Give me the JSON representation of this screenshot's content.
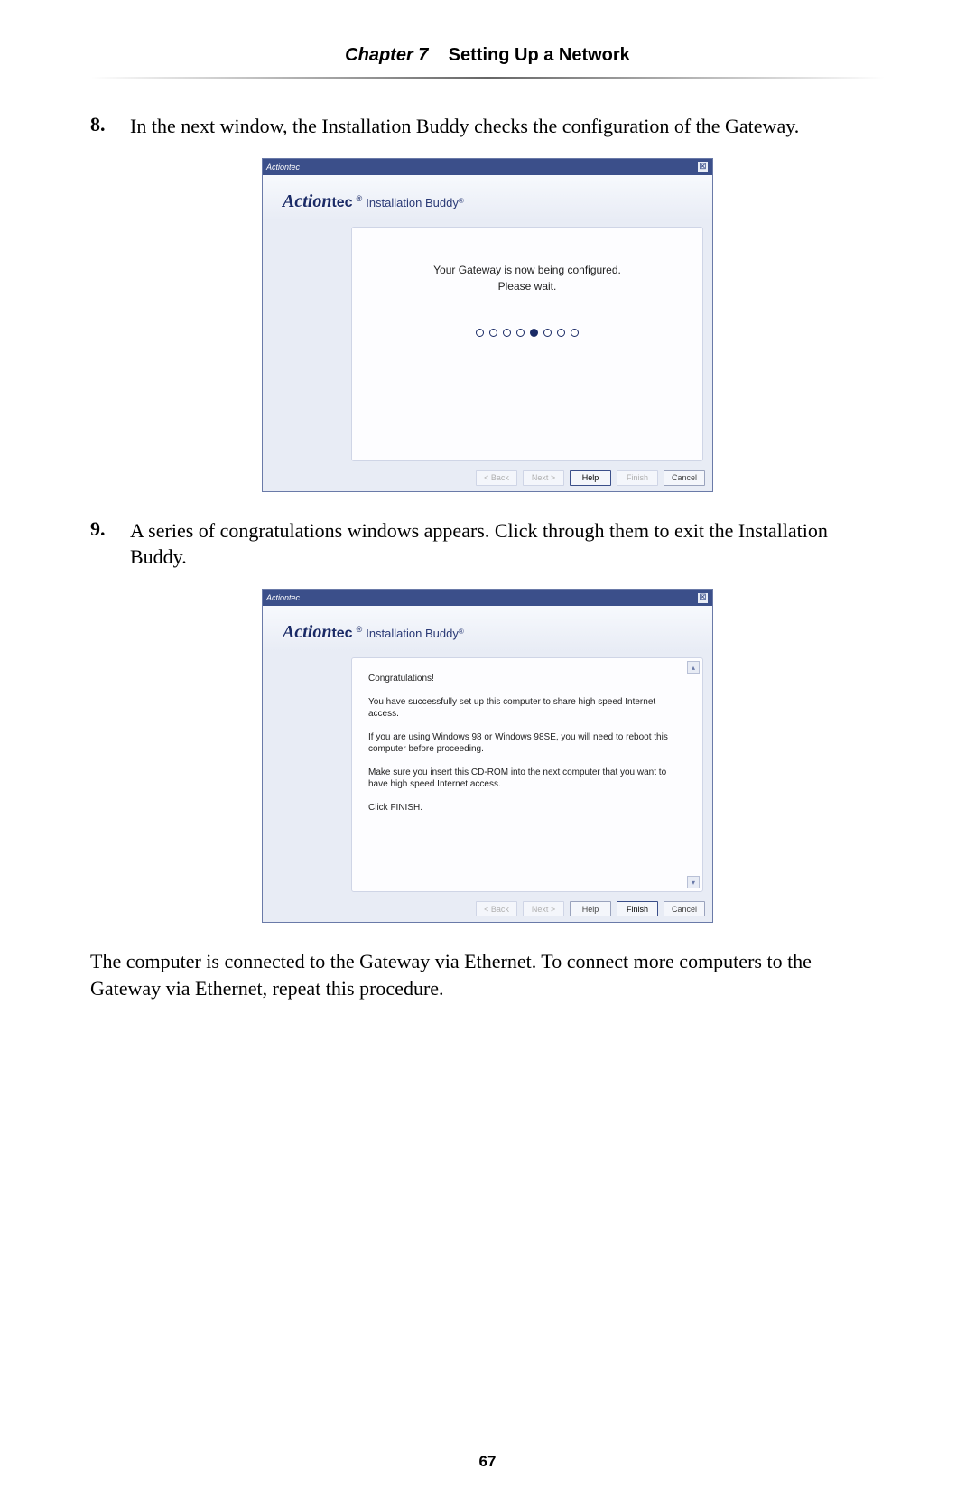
{
  "header": {
    "chapter_label": "Chapter 7",
    "title": "Setting Up a Network"
  },
  "steps": [
    {
      "num": "8.",
      "text": "In the next window, the Installation Buddy checks the configuration of the Gateway."
    },
    {
      "num": "9.",
      "text": "A series of congratulations windows appears. Click through them to exit the Installation Buddy."
    }
  ],
  "closing": "The computer is connected to the Gateway via Ethernet. To connect more computers to the Gateway via Ethernet, repeat this procedure.",
  "page_number": "67",
  "installer_common": {
    "brand_mini": "Actiontec",
    "close_glyph": "⊠",
    "logo_a": "Action",
    "logo_tec": "tec",
    "reg": "®",
    "app_name": "Installation Buddy",
    "app_reg": "®",
    "buttons": {
      "back": "< Back",
      "next": "Next >",
      "help": "Help",
      "finish": "Finish",
      "cancel": "Cancel"
    }
  },
  "fig1": {
    "line1": "Your Gateway is now being configured.",
    "line2": "Please wait.",
    "dot_count": 8,
    "filled_index": 4
  },
  "fig2": {
    "p1": "Congratulations!",
    "p2": "You have successfully set up this computer to share high speed Internet access.",
    "p3": "If you are using Windows 98 or Windows 98SE, you will need to reboot this computer before proceeding.",
    "p4": "Make sure you insert this CD-ROM into the next computer that you want to have high speed Internet access.",
    "p5": "Click FINISH.",
    "scroll_up": "▴",
    "scroll_down": "▾"
  }
}
